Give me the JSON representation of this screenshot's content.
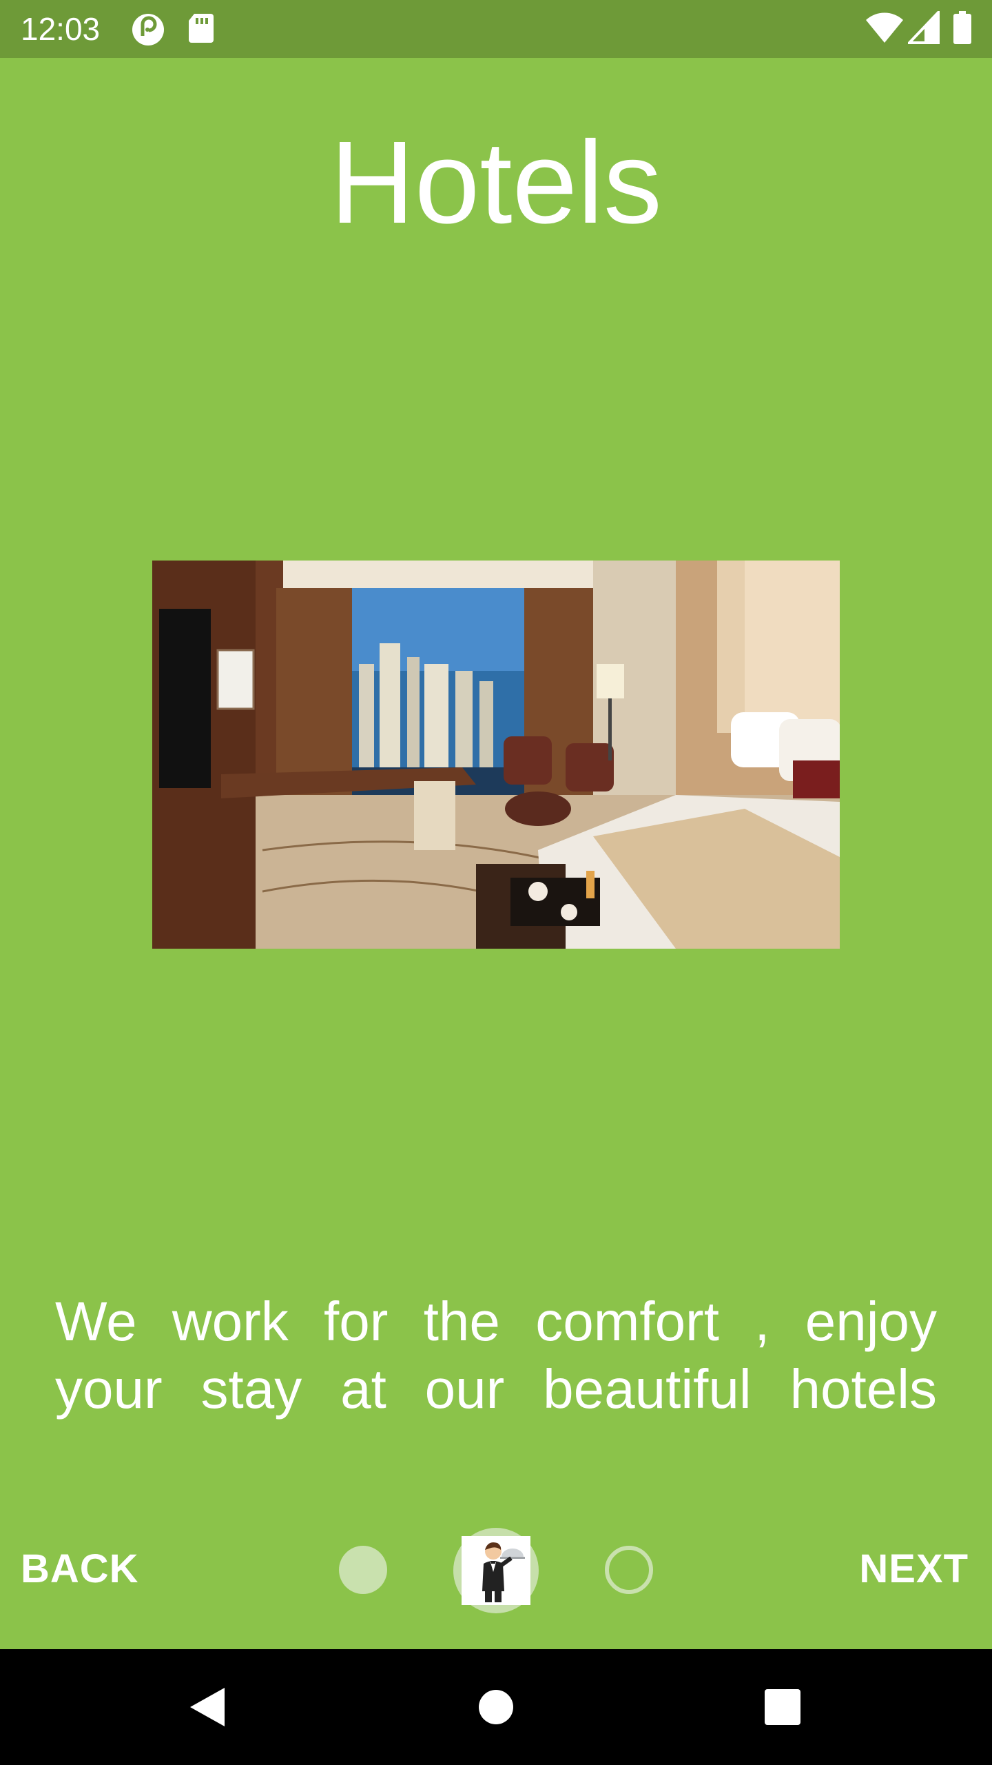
{
  "status_bar": {
    "time": "12:03",
    "left_icons": [
      "pocket-casts-icon",
      "sd-card-icon"
    ],
    "right_icons": [
      "wifi-icon",
      "cell-signal-icon",
      "battery-icon"
    ]
  },
  "page": {
    "title": "Hotels",
    "image": "hotel-room-image",
    "description": "We work for the comfort , enjoy your stay at our beautiful hotels"
  },
  "controls": {
    "back_label": "BACK",
    "next_label": "NEXT",
    "page_count": 3,
    "current_page": 2
  },
  "nav_bar": {
    "buttons": [
      "back-triangle-icon",
      "home-circle-icon",
      "recents-square-icon"
    ]
  },
  "colors": {
    "background": "#8BC34A",
    "status_bar": "#6E9A38",
    "dot_light": "#C9E1AE",
    "text": "#FFFFFF",
    "nav_bar": "#000000"
  }
}
